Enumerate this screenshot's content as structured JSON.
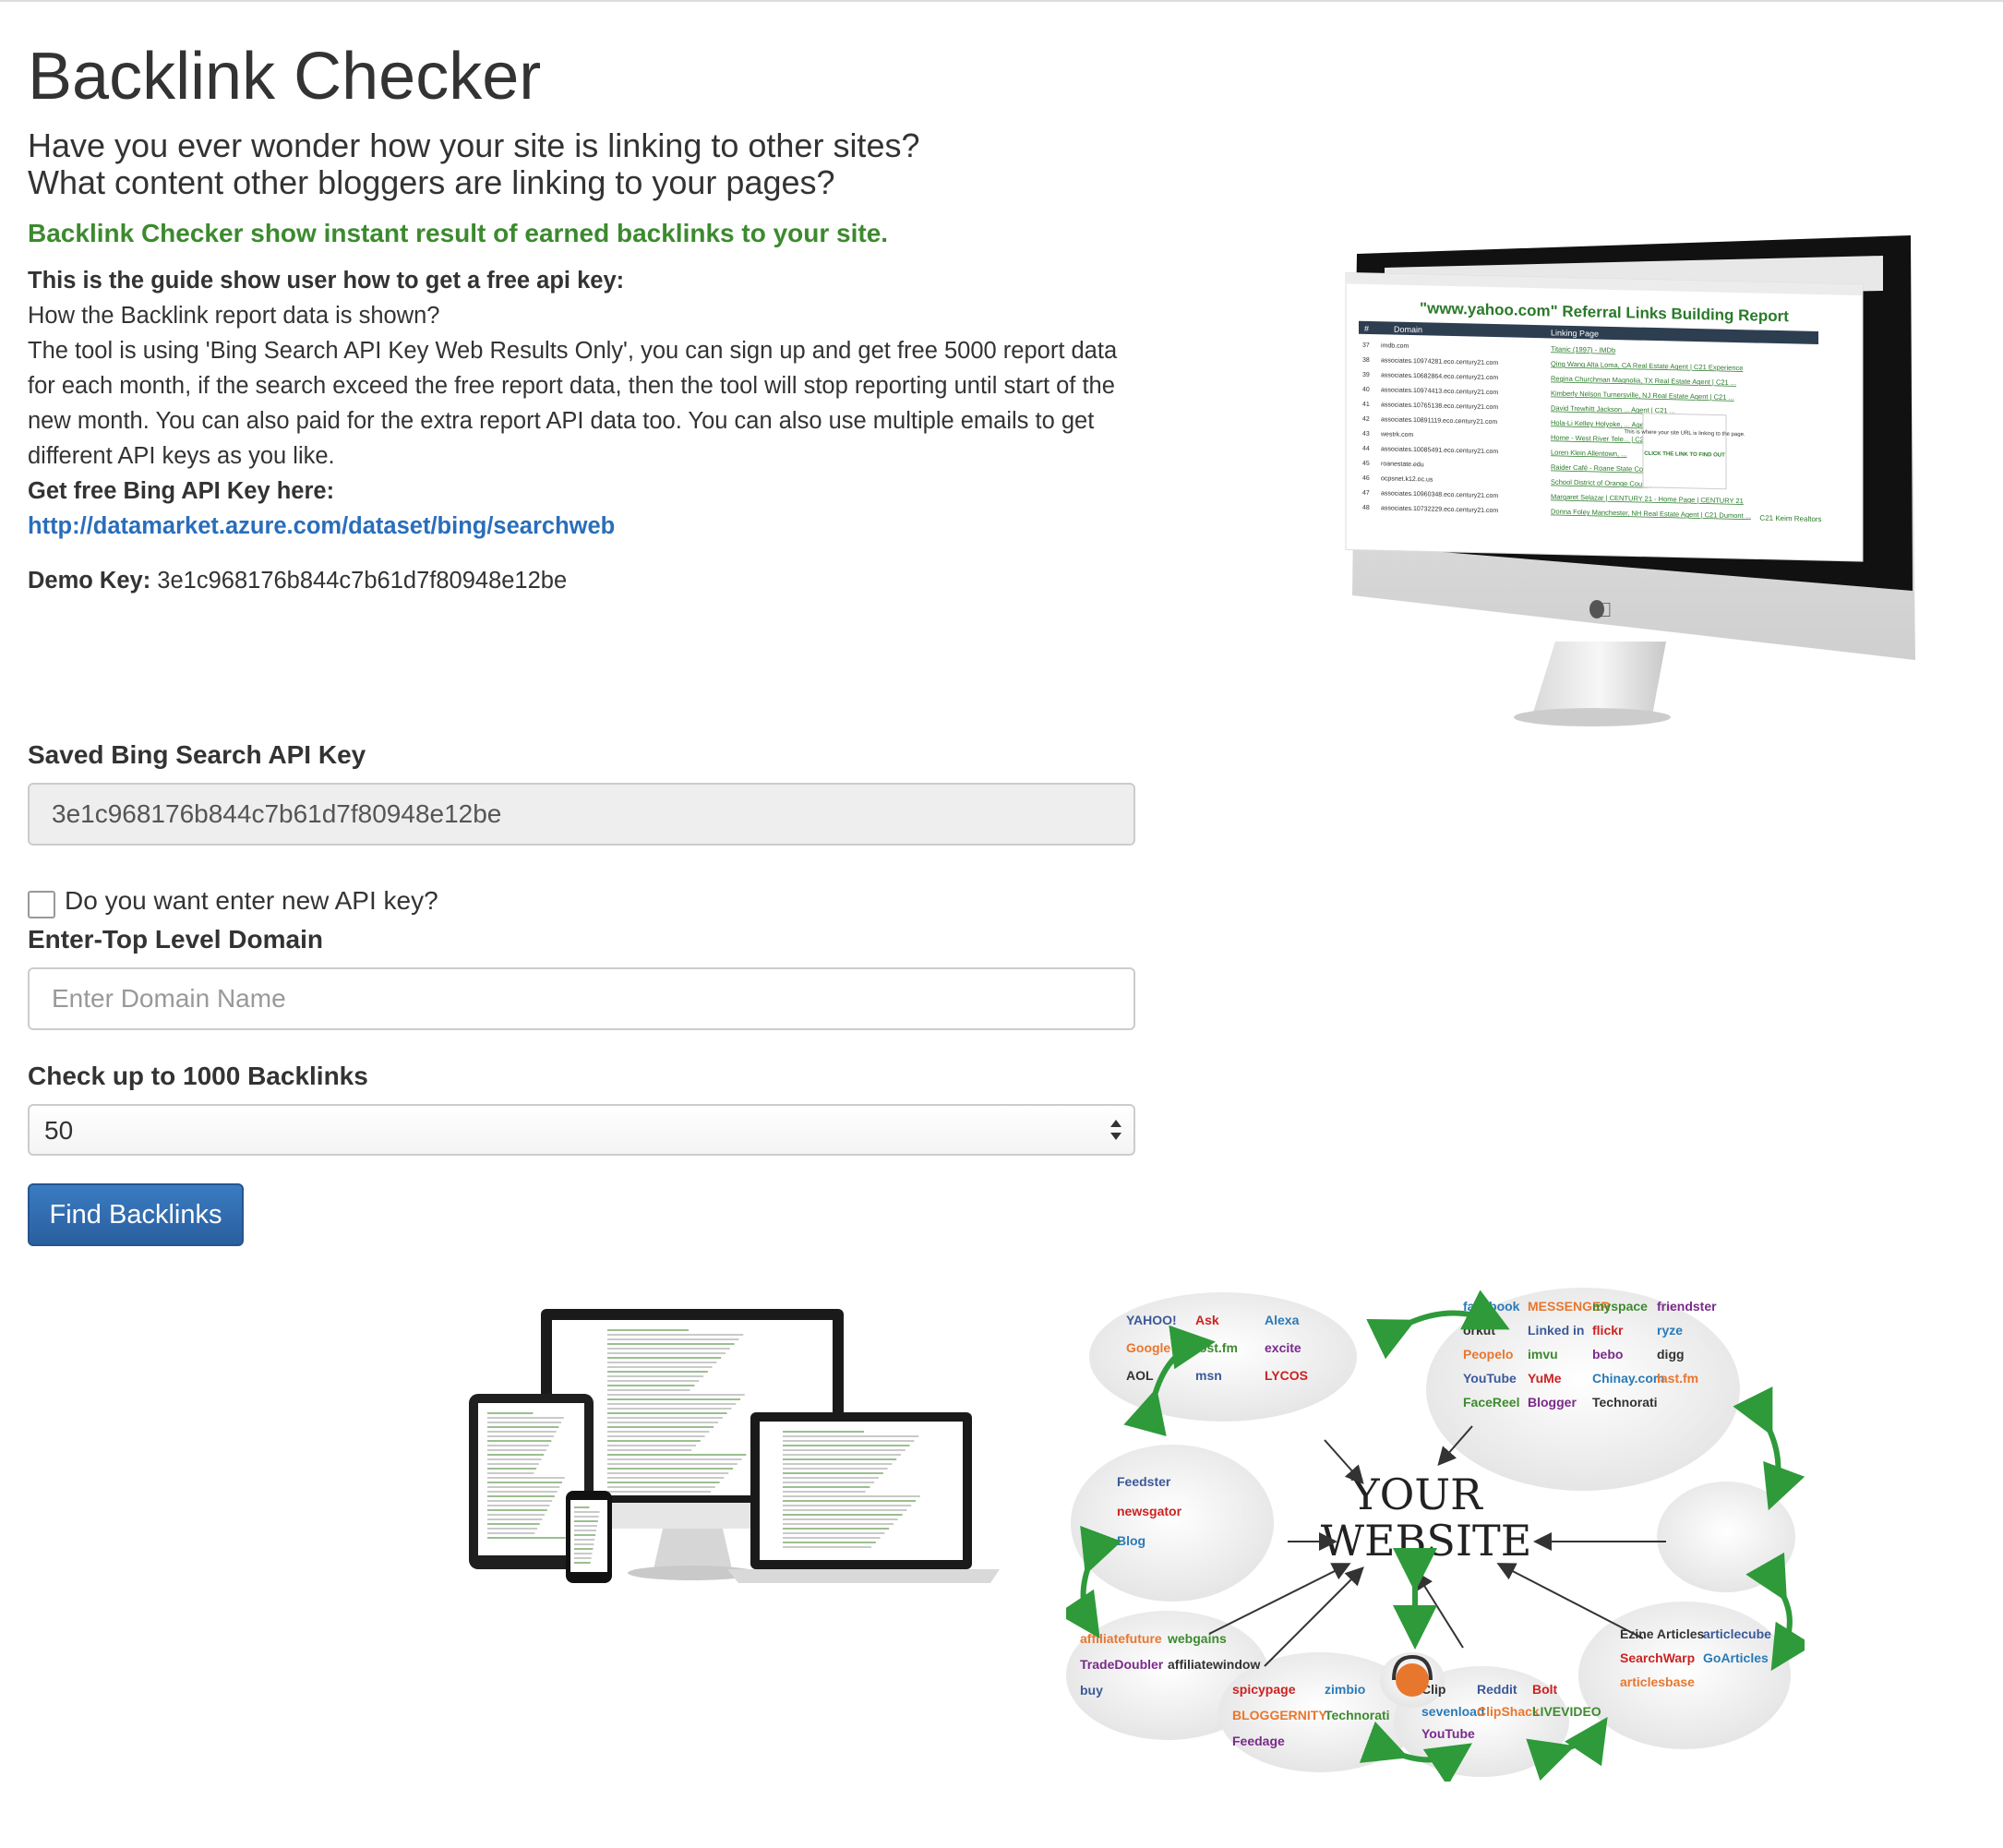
{
  "header": {
    "title": "Backlink Checker",
    "intro_line1": "Have you ever wonder how your site is linking to other sites?",
    "intro_line2": "What content other bloggers are linking to your pages?",
    "tagline": "Backlink Checker show instant result of earned backlinks to your site."
  },
  "guide": {
    "heading": "This is the guide show user how to get a free api key:",
    "question": "How the Backlink report data is shown?",
    "body": "The tool is using 'Bing Search API Key Web Results Only', you can sign up and get free 5000 report data for each month, if the search exceed the free report data, then the tool will stop reporting until start of the new month. You can also paid for the extra report API data too. You can also use multiple emails to get different API keys as you like.",
    "get_key_label": "Get free Bing API Key here:",
    "link": "http://datamarket.azure.com/dataset/bing/searchweb",
    "demo_label": "Demo Key:",
    "demo_key": "3e1c968176b844c7b61d7f80948e12be"
  },
  "form": {
    "saved_key_label": "Saved Bing Search API Key",
    "saved_key_value": "3e1c968176b844c7b61d7f80948e12be",
    "new_key_checkbox_label": "Do you want enter new API key?",
    "new_key_checked": false,
    "domain_label": "Enter-Top Level Domain",
    "domain_placeholder": "Enter Domain Name",
    "domain_value": "",
    "count_label": "Check up to 1000 Backlinks",
    "count_value": "50",
    "submit_label": "Find Backlinks"
  },
  "monitor_image": {
    "report_title": "\"www.yahoo.com\" Referral Links Building Report",
    "col_number": "#",
    "col_domain": "Domain",
    "col_page": "Linking Page",
    "rows": [
      {
        "n": "37",
        "domain": "imdb.com",
        "page": "Titanic (1997) - IMDb"
      },
      {
        "n": "38",
        "domain": "associates.10974281.eco.century21.com",
        "page": "Qing Wang Alta Loma, CA Real Estate Agent | C21 Experience"
      },
      {
        "n": "39",
        "domain": "associates.10682864.eco.century21.com",
        "page": "Regina Churchman Magnolia, TX Real Estate Agent | C21 ..."
      },
      {
        "n": "40",
        "domain": "associates.10974413.eco.century21.com",
        "page": "Kimberly Nelson Turnersville, NJ Real Estate Agent | C21 ..."
      },
      {
        "n": "41",
        "domain": "associates.10765138.eco.century21.com",
        "page": "David Trewhitt Jackson ... Agent | C21 ..."
      },
      {
        "n": "42",
        "domain": "associates.10891119.eco.century21.com",
        "page": "Hola-Li Kelley Holyoke, ... Agent | C21 ..."
      },
      {
        "n": "43",
        "domain": "westrk.com",
        "page": "Home - West River Tele... | C21 ..."
      },
      {
        "n": "44",
        "domain": "associates.10085491.eco.century21.com",
        "page": "Loren Klein Allentown, ..."
      },
      {
        "n": "45",
        "domain": "roanestate.edu",
        "page": "Raider Café - Roane State Community College"
      },
      {
        "n": "46",
        "domain": "ocpsnet.k12.oc.us",
        "page": "School District of Orange County"
      },
      {
        "n": "47",
        "domain": "associates.10960348.eco.century21.com",
        "page": "Margaret Selazar | CENTURY 21 - Home Page | CENTURY 21"
      },
      {
        "n": "48",
        "domain": "associates.10732229.eco.century21.com",
        "page": "Donna Foley Manchester, NH Real Estate Agent | C21 Dumont ..."
      }
    ],
    "callout_text": "This is where your site URL is linking to the page.",
    "callout_action": "CLICK THE LINK TO FIND OUT",
    "extra_rows_label": "C21 Keim Realtors"
  },
  "network_image": {
    "center_line1": "YOUR",
    "center_line2": "WEBSITE",
    "logos_top_left": [
      "YAHOO!",
      "Ask",
      "Alexa",
      "Google",
      "lost.fm",
      "excite",
      "AOL",
      "msn",
      "LYCOS"
    ],
    "logos_top_right": [
      "facebook",
      "MESSENGER",
      "myspace",
      "friendster",
      "orkut",
      "Linked in",
      "flickr",
      "ryze",
      "Peopelo",
      "imvu",
      "bebo",
      "digg",
      "YouTube",
      "YuMe",
      "Chinay.com",
      "last.fm",
      "FaceReel",
      "Blogger",
      "Technorati"
    ],
    "logos_left": [
      "Feedster",
      "newsgator",
      "Blog"
    ],
    "logos_bottom_left": [
      "affiliatefuture",
      "webgains",
      "TradeDoubler",
      "affiliatewindow",
      "buy"
    ],
    "logos_bottom_mid": [
      "spicypage",
      "zimbio",
      "BLOGGERNITY",
      "Technorati",
      "Feedage"
    ],
    "logos_bottom_right": [
      "Clip",
      "Reddit",
      "Bolt",
      "sevenload",
      "ClipShack",
      "LIVEVIDEO",
      "YouTube"
    ],
    "logos_right": [
      "Ezine Articles",
      "articlecube",
      "SearchWarp",
      "GoArticles",
      "articlesbase"
    ]
  },
  "colors": {
    "tagline_green": "#3c8a2e",
    "link_blue": "#2a6ebb",
    "button_blue": "#2a6bb0",
    "arrow_green": "#2e9a3a"
  }
}
